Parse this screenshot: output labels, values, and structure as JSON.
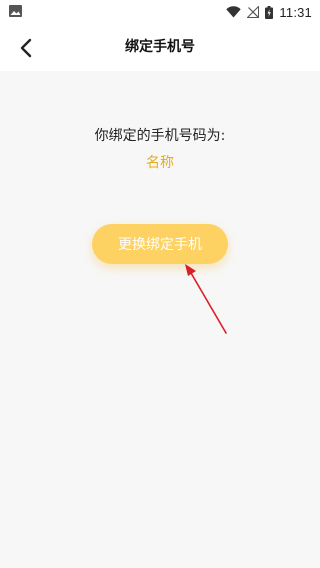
{
  "status_bar": {
    "time": "11:31",
    "icons": [
      "image-icon",
      "wifi-icon",
      "no-signal-icon",
      "battery-icon"
    ]
  },
  "nav": {
    "title": "绑定手机号",
    "back_icon": "chevron-left-icon"
  },
  "main": {
    "prompt": "你绑定的手机号码为:",
    "bound_phone": "名称",
    "change_button_label": "更换绑定手机"
  },
  "colors": {
    "accent": "#e6ac1e",
    "button": "#fdd162",
    "annotation": "#d91f26",
    "background": "#f7f7f7"
  }
}
